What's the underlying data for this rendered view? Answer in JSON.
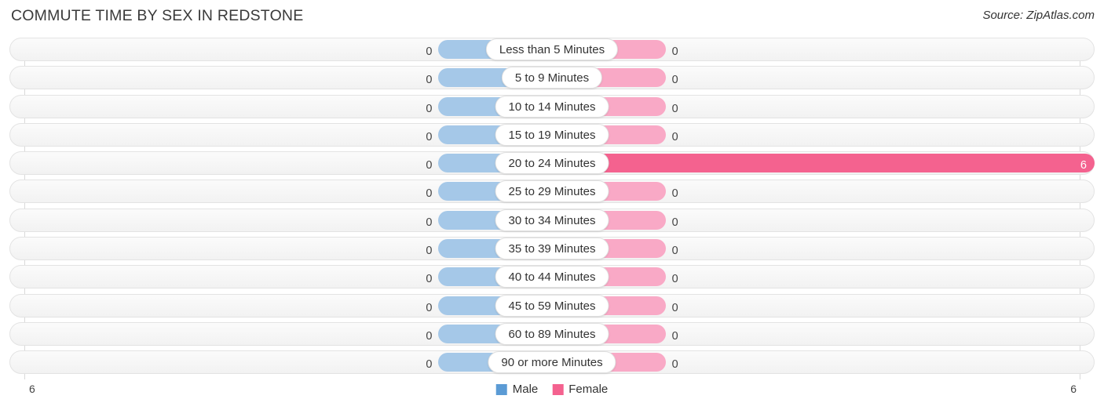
{
  "header": {
    "title": "COMMUTE TIME BY SEX IN REDSTONE",
    "source": "Source: ZipAtlas.com"
  },
  "legend": {
    "male_label": "Male",
    "female_label": "Female",
    "male_color": "#5b9bd5",
    "female_color": "#f4628f"
  },
  "axis": {
    "left_label": "6",
    "right_label": "6"
  },
  "chart_data": {
    "type": "bar",
    "title": "COMMUTE TIME BY SEX IN REDSTONE",
    "subtitle": "Source: ZipAtlas.com",
    "orientation": "horizontal-diverging",
    "xlabel": "",
    "ylabel": "",
    "xlim": [
      6,
      6
    ],
    "grid": true,
    "legend_position": "bottom-center",
    "categories": [
      "Less than 5 Minutes",
      "5 to 9 Minutes",
      "10 to 14 Minutes",
      "15 to 19 Minutes",
      "20 to 24 Minutes",
      "25 to 29 Minutes",
      "30 to 34 Minutes",
      "35 to 39 Minutes",
      "40 to 44 Minutes",
      "45 to 59 Minutes",
      "60 to 89 Minutes",
      "90 or more Minutes"
    ],
    "series": [
      {
        "name": "Male",
        "color": "#a5c8e8",
        "values": [
          0,
          0,
          0,
          0,
          0,
          0,
          0,
          0,
          0,
          0,
          0,
          0
        ]
      },
      {
        "name": "Female",
        "color": "#f9a9c6",
        "highlight_color": "#f4628f",
        "values": [
          0,
          0,
          0,
          0,
          6,
          0,
          0,
          0,
          0,
          0,
          0,
          0
        ]
      }
    ]
  },
  "rows": [
    {
      "label": "Less than 5 Minutes",
      "male": "0",
      "female": "0",
      "male_pct": 20,
      "female_pct": 20,
      "female_highlight": false,
      "female_inside": false
    },
    {
      "label": "5 to 9 Minutes",
      "male": "0",
      "female": "0",
      "male_pct": 20,
      "female_pct": 20,
      "female_highlight": false,
      "female_inside": false
    },
    {
      "label": "10 to 14 Minutes",
      "male": "0",
      "female": "0",
      "male_pct": 20,
      "female_pct": 20,
      "female_highlight": false,
      "female_inside": false
    },
    {
      "label": "15 to 19 Minutes",
      "male": "0",
      "female": "0",
      "male_pct": 20,
      "female_pct": 20,
      "female_highlight": false,
      "female_inside": false
    },
    {
      "label": "20 to 24 Minutes",
      "male": "0",
      "female": "6",
      "male_pct": 20,
      "female_pct": 100,
      "female_highlight": true,
      "female_inside": true
    },
    {
      "label": "25 to 29 Minutes",
      "male": "0",
      "female": "0",
      "male_pct": 20,
      "female_pct": 20,
      "female_highlight": false,
      "female_inside": false
    },
    {
      "label": "30 to 34 Minutes",
      "male": "0",
      "female": "0",
      "male_pct": 20,
      "female_pct": 20,
      "female_highlight": false,
      "female_inside": false
    },
    {
      "label": "35 to 39 Minutes",
      "male": "0",
      "female": "0",
      "male_pct": 20,
      "female_pct": 20,
      "female_highlight": false,
      "female_inside": false
    },
    {
      "label": "40 to 44 Minutes",
      "male": "0",
      "female": "0",
      "male_pct": 20,
      "female_pct": 20,
      "female_highlight": false,
      "female_inside": false
    },
    {
      "label": "45 to 59 Minutes",
      "male": "0",
      "female": "0",
      "male_pct": 20,
      "female_pct": 20,
      "female_highlight": false,
      "female_inside": false
    },
    {
      "label": "60 to 89 Minutes",
      "male": "0",
      "female": "0",
      "male_pct": 20,
      "female_pct": 20,
      "female_highlight": false,
      "female_inside": false
    },
    {
      "label": "90 or more Minutes",
      "male": "0",
      "female": "0",
      "male_pct": 20,
      "female_pct": 20,
      "female_highlight": false,
      "female_inside": false
    }
  ]
}
